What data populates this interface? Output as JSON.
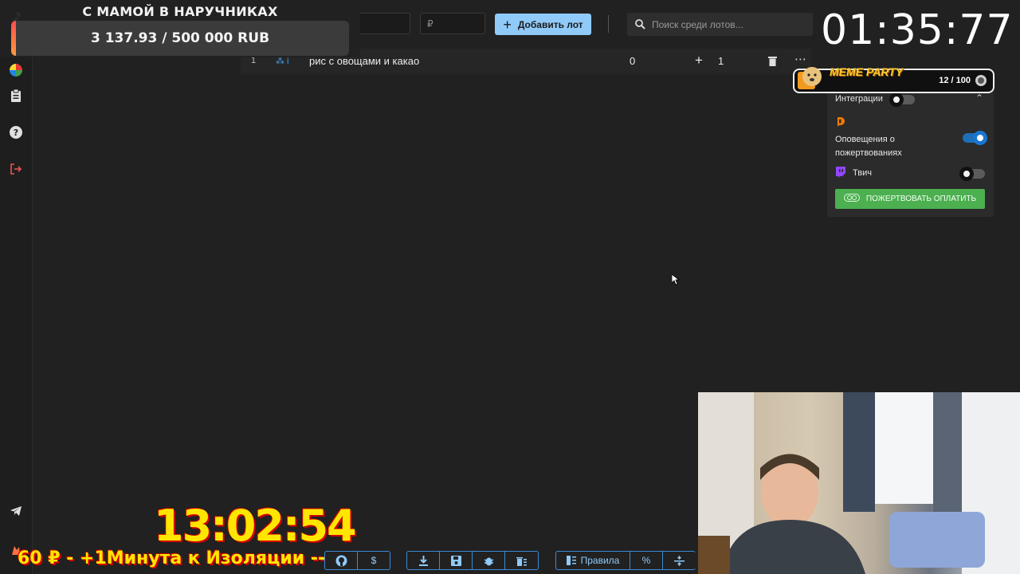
{
  "goal": {
    "title": "С МАМОЙ В НАРУЧНИКАХ",
    "amount": "3 137.93 / 500 000 RUB",
    "progress_fraction": 0.0063
  },
  "toolbar": {
    "currency_placeholder": "₽",
    "add_lot_label": "Добавить лот",
    "search_placeholder": "Поиск среди лотов..."
  },
  "lots": [
    {
      "index": "1",
      "name": "рис с овощами и какао",
      "amount": "0",
      "plus": "+",
      "add_value": "1"
    }
  ],
  "timer": {
    "value": "01:35:77"
  },
  "meme_party": {
    "title": "MEME PARTY",
    "count": "12 / 100"
  },
  "integrations": {
    "header": "Интеграции",
    "donation_alerts_label": "Оповещения о пожертвованиях",
    "donation_alerts_on": true,
    "twitch_label": "Твич",
    "twitch_on": false,
    "donate_button": "ПОЖЕРТВОВАТЬ ОПЛАТИТЬ"
  },
  "stream_overlay": {
    "countdown": "13:02:54",
    "ticker": "60 ₽ - +1Минута к Изоляции ----"
  },
  "bottom_toolbar": {
    "rules_label": "Правила",
    "dollar_label": "$",
    "percent_label": "%"
  },
  "colors": {
    "background": "#212121",
    "accent_blue": "#90caf9",
    "toggle_blue": "#1976d2",
    "donate_green": "#4caf50",
    "delete_red": "#ef5350"
  }
}
